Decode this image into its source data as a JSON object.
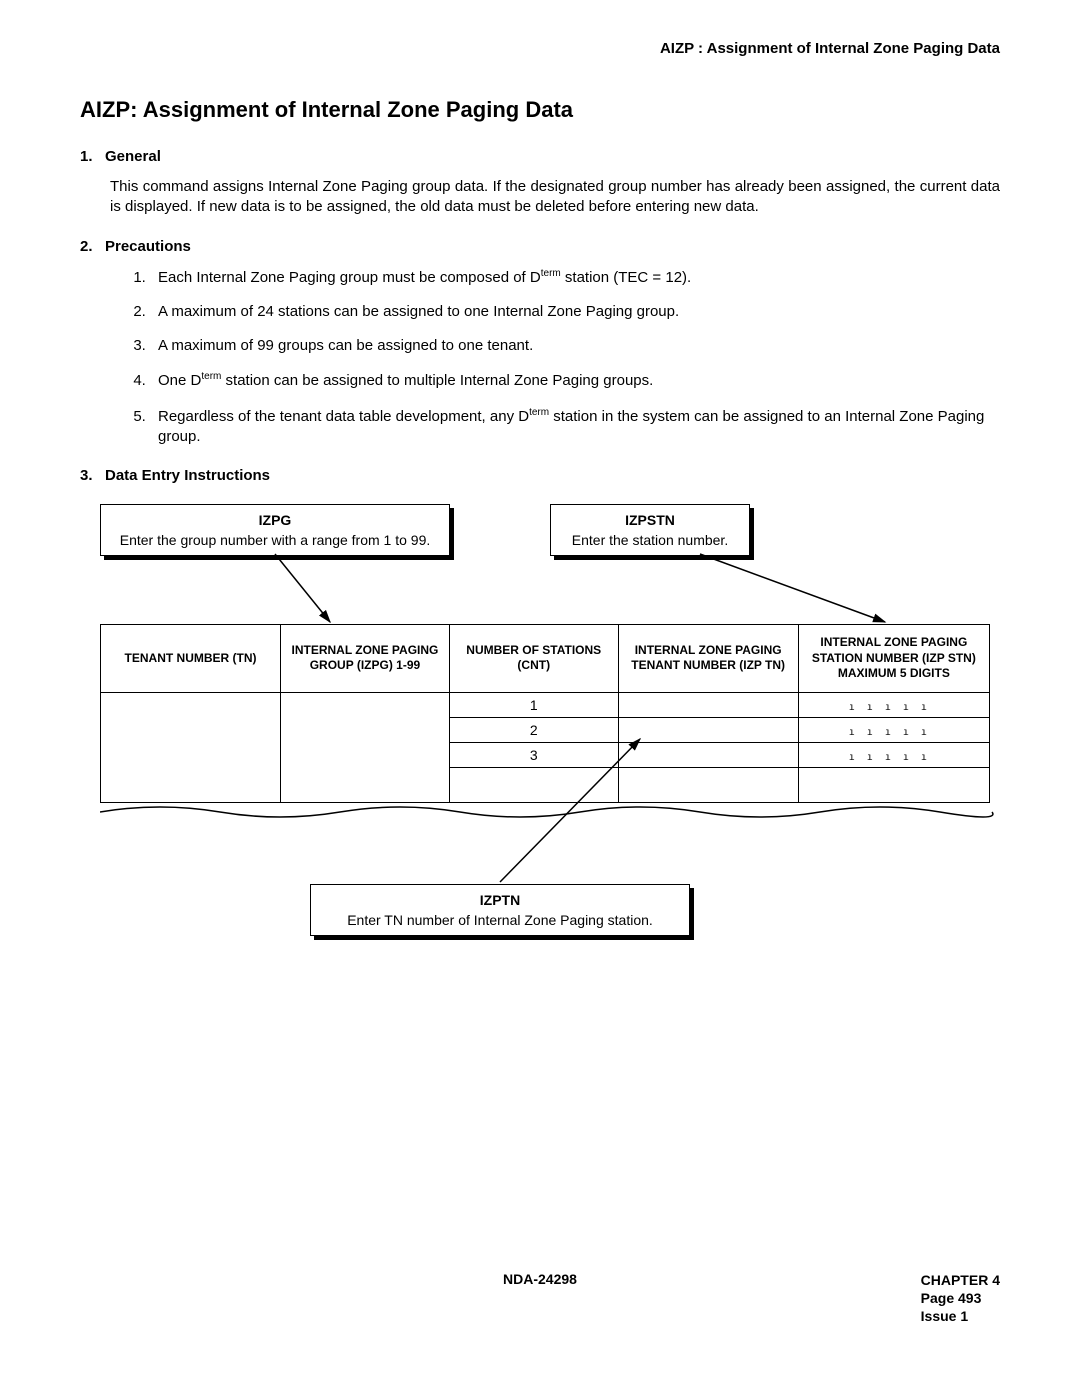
{
  "running_head": "AIZP : Assignment of Internal Zone Paging Data",
  "title": "AIZP: Assignment of Internal Zone Paging Data",
  "sections": {
    "s1": {
      "num": "1.",
      "label": "General",
      "body": "This command assigns Internal Zone Paging group data. If the designated group number has already been assigned, the current data is displayed. If new data is to be assigned, the old data must be deleted before entering new data."
    },
    "s2": {
      "num": "2.",
      "label": "Precautions"
    },
    "s3": {
      "num": "3.",
      "label": "Data Entry Instructions"
    }
  },
  "precautions": {
    "p1a": "Each Internal Zone Paging group must be composed of D",
    "p1b": " station (TEC = 12).",
    "p2": "A maximum of 24 stations can be assigned to one Internal Zone Paging group.",
    "p3": "A maximum of 99 groups can be assigned to one tenant.",
    "p4a": "One D",
    "p4b": " station can be assigned to multiple Internal Zone Paging groups.",
    "p5a": "Regardless of the tenant data table development, any D",
    "p5b": " station in the system can be assigned to an Internal Zone Paging group.",
    "sup": "term"
  },
  "callouts": {
    "izpg": {
      "title": "IZPG",
      "text": "Enter the group number with a range from 1 to 99."
    },
    "izpstn": {
      "title": "IZPSTN",
      "text": "Enter the station number."
    },
    "izptn": {
      "title": "IZPTN",
      "text": "Enter TN number of Internal Zone Paging station."
    }
  },
  "table": {
    "h1": "TENANT NUMBER (TN)",
    "h2": "INTERNAL ZONE PAGING GROUP (IZPG) 1-99",
    "h3": "NUMBER OF STATIONS (CNT)",
    "h4": "INTERNAL ZONE PAGING TENANT NUMBER (IZP TN)",
    "h5": "INTERNAL ZONE PAGING STATION NUMBER (IZP STN) MAXIMUM 5 DIGITS",
    "r1": "1",
    "r2": "2",
    "r3": "3"
  },
  "footer": {
    "doc": "NDA-24298",
    "chapter": "CHAPTER 4",
    "page": "Page 493",
    "issue": "Issue 1"
  }
}
